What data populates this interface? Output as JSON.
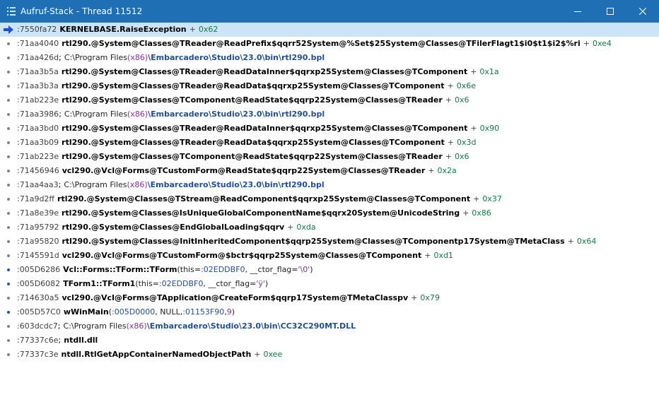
{
  "window": {
    "title": "Aufruf-Stack - Thread 11512",
    "icons": {
      "grip": "grip-icon",
      "minimize": "minimize-icon",
      "maximize": "maximize-icon",
      "close": "close-icon"
    }
  },
  "colors": {
    "titlebar": "#1f6fb4",
    "selection": "#cce4f7",
    "offset": "#107c41",
    "purple": "#8b2fa8",
    "path": "#1f4f9a"
  },
  "frames": [
    {
      "addr": ":7550fa72",
      "name": "KERNELBASE.RaiseException",
      "offset": "0x62"
    },
    {
      "addr": ":71aa4040",
      "name": "rtl290.@System@Classes@TReader@ReadPrefix$qqrr52System@%Set$25System@Classes@TFilerFlagt1$i0$t1$i2$%ri",
      "offset": "0xe4"
    },
    {
      "addr": ":71aa426d",
      "path_pre": "C:\\Program Files ",
      "path_x86": "(x86)",
      "path_rest": "\\Embarcadero\\Studio\\23.0\\bin\\rtl290.bpl"
    },
    {
      "addr": ":71aa3b5a",
      "name": "rtl290.@System@Classes@TReader@ReadDataInner$qqrxp25System@Classes@TComponent",
      "offset": "0x1a"
    },
    {
      "addr": ":71aa3b3a",
      "name": "rtl290.@System@Classes@TReader@ReadData$qqrxp25System@Classes@TComponent",
      "offset": "0x6e"
    },
    {
      "addr": ":71ab223e",
      "name": "rtl290.@System@Classes@TComponent@ReadState$qqrp22System@Classes@TReader",
      "offset": "0x6"
    },
    {
      "addr": ":71aa3986",
      "path_pre": "C:\\Program Files ",
      "path_x86": "(x86)",
      "path_rest": "\\Embarcadero\\Studio\\23.0\\bin\\rtl290.bpl"
    },
    {
      "addr": ":71aa3bd0",
      "name": "rtl290.@System@Classes@TReader@ReadDataInner$qqrxp25System@Classes@TComponent",
      "offset": "0x90"
    },
    {
      "addr": ":71aa3b09",
      "name": "rtl290.@System@Classes@TReader@ReadData$qqrxp25System@Classes@TComponent",
      "offset": "0x3d"
    },
    {
      "addr": ":71ab223e",
      "name": "rtl290.@System@Classes@TComponent@ReadState$qqrp22System@Classes@TReader",
      "offset": "0x6"
    },
    {
      "addr": ":71456946",
      "name": "vcl290.@Vcl@Forms@TCustomForm@ReadState$qqrp22System@Classes@TReader",
      "offset": "0x2a"
    },
    {
      "addr": ":71aa4aa3",
      "path_pre": "C:\\Program Files ",
      "path_x86": "(x86)",
      "path_rest": "\\Embarcadero\\Studio\\23.0\\bin\\rtl290.bpl"
    },
    {
      "addr": ":71a9d2ff",
      "name": "rtl290.@System@Classes@TStream@ReadComponent$qqrxp25System@Classes@TComponent",
      "offset": "0x37"
    },
    {
      "addr": ":71a8e39e",
      "name": "rtl290.@System@Classes@IsUniqueGlobalComponentName$qqrx20System@UnicodeString",
      "offset": "0x86"
    },
    {
      "addr": ":71a95792",
      "name": "rtl290.@System@Classes@EndGlobalLoading$qqrv",
      "offset": "0xda"
    },
    {
      "addr": ":71a95820",
      "name": "rtl290.@System@Classes@InitInheritedComponent$qqrp25System@Classes@TComponentp17System@TMetaClass",
      "offset": "0x64"
    },
    {
      "addr": ":7145591d",
      "name": "vcl290.@Vcl@Forms@TCustomForm@$bctr$qqrp25System@Classes@TComponent",
      "offset": "0xd1"
    },
    {
      "addr": ":005D6286",
      "name": "Vcl::Forms::TForm::TForm",
      "args_open": "(this=",
      "arg1": ":02EDDBF0",
      "args_mid": ", __ctor_flag=",
      "arg2": "'\\0'",
      "args_close": ")",
      "dot": "blue"
    },
    {
      "addr": ":005D6082",
      "name": "TForm1::TForm1",
      "args_open": "(this=",
      "arg1": ":02EDDBF0",
      "args_mid": ", __ctor_flag=",
      "arg2": "'ÿ'",
      "args_close": ")",
      "dot": "blue"
    },
    {
      "addr": ":714630a5",
      "name": "vcl290.@Vcl@Forms@TApplication@CreateForm$qqrp17System@TMetaClasspv",
      "offset": "0x79"
    },
    {
      "addr": ":005D57C0",
      "name": "wWinMain",
      "args_open": "(",
      "arg1": ":005D0000",
      "args_mid": ", NULL, ",
      "arg2": ":01153F90",
      "args_mid2": ", ",
      "arg3": "9",
      "args_close": ")",
      "dot": "blue"
    },
    {
      "addr": ":603dcdc7",
      "path_pre": "C:\\Program Files ",
      "path_x86": "(x86)",
      "path_rest": "\\Embarcadero\\Studio\\23.0\\bin\\CC32C290MT.DLL"
    },
    {
      "addr": ":77337c6e",
      "name_sep": "; ",
      "name": "ntdll.dll"
    },
    {
      "addr": ":77337c3e",
      "name": "ntdll.RtlGetAppContainerNamedObjectPath",
      "offset": "0xee"
    }
  ]
}
